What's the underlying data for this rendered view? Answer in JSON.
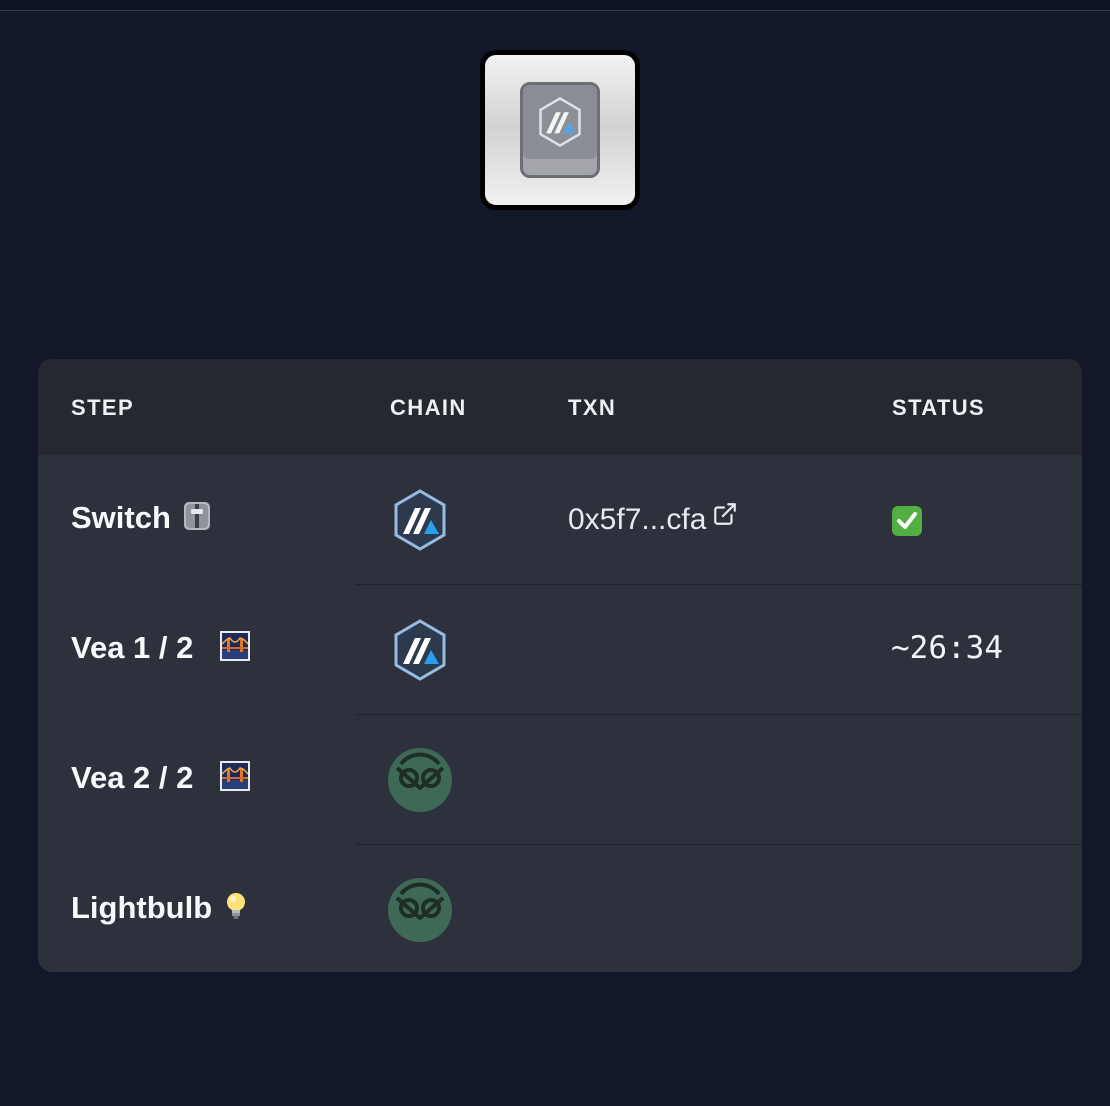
{
  "header": {
    "logo": {
      "icon": "arbitrum-keycap-icon"
    }
  },
  "table": {
    "columns": {
      "step": "STEP",
      "chain": "CHAIN",
      "txn": "TXN",
      "status": "STATUS"
    },
    "rows": [
      {
        "step": "Switch",
        "step_icon": "switch-emoji-icon",
        "chain_icon": "arbitrum-icon",
        "txn": "0x5f7...cfa",
        "txn_icon": "external-link-icon",
        "status_icon": "checkmark-icon",
        "status": ""
      },
      {
        "step": "Vea 1 / 2",
        "step_icon": "bridge-at-night-emoji-icon",
        "chain_icon": "arbitrum-icon",
        "txn": "",
        "status": "~26:34"
      },
      {
        "step": "Vea 2 / 2",
        "step_icon": "bridge-at-night-emoji-icon",
        "chain_icon": "gnosis-icon",
        "txn": "",
        "status": ""
      },
      {
        "step": "Lightbulb",
        "step_icon": "lightbulb-emoji-icon",
        "chain_icon": "gnosis-icon",
        "txn": "",
        "status": ""
      }
    ]
  },
  "colors": {
    "background": "#12172a",
    "table_body": "#2d313b",
    "table_header": "#25282f",
    "arbitrum_blue": "#28a0f0",
    "gnosis_green": "#3e6957",
    "check_green": "#4caf50"
  }
}
